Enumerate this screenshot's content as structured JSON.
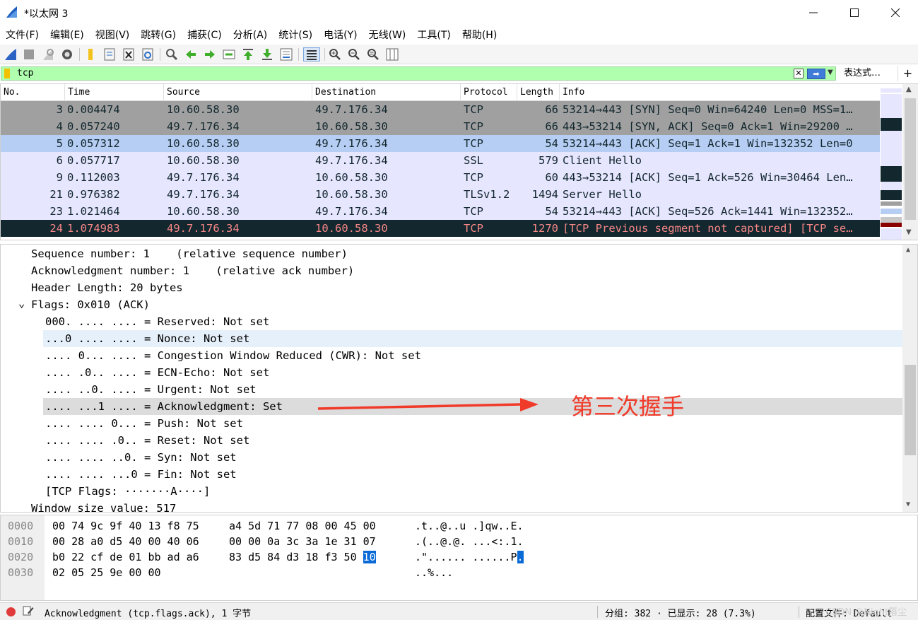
{
  "window": {
    "title": "*以太网 3"
  },
  "menu": [
    "文件(F)",
    "编辑(E)",
    "视图(V)",
    "跳转(G)",
    "捕获(C)",
    "分析(A)",
    "统计(S)",
    "电话(Y)",
    "无线(W)",
    "工具(T)",
    "帮助(H)"
  ],
  "toolbar": {
    "icons": [
      "start-capture-icon",
      "stop-capture-icon",
      "restart-capture-icon",
      "capture-options-icon",
      "open-file-icon",
      "save-file-icon",
      "close-file-icon",
      "reload-file-icon",
      "find-packet-icon",
      "go-back-icon",
      "go-forward-icon",
      "go-to-packet-icon",
      "go-first-icon",
      "go-last-icon",
      "autoscroll-icon",
      "colorize-icon",
      "zoom-in-icon",
      "zoom-out-icon",
      "zoom-normal-icon",
      "resize-columns-icon"
    ]
  },
  "filter": {
    "value": "tcp",
    "expression_label": "表达式…",
    "add_label": "+"
  },
  "packet_list": {
    "columns": [
      "No.",
      "Time",
      "Source",
      "Destination",
      "Protocol",
      "Length",
      "Info"
    ],
    "rows": [
      {
        "no": "3",
        "time": "0.004474",
        "src": "10.60.58.30",
        "dst": "49.7.176.34",
        "proto": "TCP",
        "len": "66",
        "info": "53214→443 [SYN] Seq=0 Win=64240 Len=0 MSS=1…",
        "bg": "#a0a0a0",
        "fg": "#12272e"
      },
      {
        "no": "4",
        "time": "0.057240",
        "src": "49.7.176.34",
        "dst": "10.60.58.30",
        "proto": "TCP",
        "len": "66",
        "info": "443→53214 [SYN, ACK] Seq=0 Ack=1 Win=29200 …",
        "bg": "#a0a0a0",
        "fg": "#12272e"
      },
      {
        "no": "5",
        "time": "0.057312",
        "src": "10.60.58.30",
        "dst": "49.7.176.34",
        "proto": "TCP",
        "len": "54",
        "info": "53214→443 [ACK] Seq=1 Ack=1 Win=132352 Len=0",
        "bg": "#b6cef3",
        "fg": "#12272e"
      },
      {
        "no": "6",
        "time": "0.057717",
        "src": "10.60.58.30",
        "dst": "49.7.176.34",
        "proto": "SSL",
        "len": "579",
        "info": "Client Hello",
        "bg": "#e7e6ff",
        "fg": "#12272e"
      },
      {
        "no": "9",
        "time": "0.112003",
        "src": "49.7.176.34",
        "dst": "10.60.58.30",
        "proto": "TCP",
        "len": "60",
        "info": "443→53214 [ACK] Seq=1 Ack=526 Win=30464 Len…",
        "bg": "#e7e6ff",
        "fg": "#12272e"
      },
      {
        "no": "21",
        "time": "0.976382",
        "src": "49.7.176.34",
        "dst": "10.60.58.30",
        "proto": "TLSv1.2",
        "len": "1494",
        "info": "Server Hello",
        "bg": "#e7e6ff",
        "fg": "#12272e"
      },
      {
        "no": "23",
        "time": "1.021464",
        "src": "10.60.58.30",
        "dst": "49.7.176.34",
        "proto": "TCP",
        "len": "54",
        "info": "53214→443 [ACK] Seq=526 Ack=1441 Win=132352…",
        "bg": "#e7e6ff",
        "fg": "#12272e"
      },
      {
        "no": "24",
        "time": "1.074983",
        "src": "49.7.176.34",
        "dst": "10.60.58.30",
        "proto": "TCP",
        "len": "1270",
        "info": "[TCP Previous segment not captured] [TCP se…",
        "bg": "#12272e",
        "fg": "#f78787"
      }
    ]
  },
  "details": {
    "lines": [
      {
        "text": "Sequence number: 1    (relative sequence number)",
        "indent": 0,
        "toggle": ""
      },
      {
        "text": "Acknowledgment number: 1    (relative ack number)",
        "indent": 0,
        "toggle": ""
      },
      {
        "text": "Header Length: 20 bytes",
        "indent": 0,
        "toggle": ""
      },
      {
        "text": "Flags: 0x010 (ACK)",
        "indent": 0,
        "toggle": "⌄"
      },
      {
        "text": "000. .... .... = Reserved: Not set",
        "indent": 1,
        "toggle": ""
      },
      {
        "text": "...0 .... .... = Nonce: Not set",
        "indent": 1,
        "toggle": "",
        "hover": true
      },
      {
        "text": ".... 0... .... = Congestion Window Reduced (CWR): Not set",
        "indent": 1,
        "toggle": ""
      },
      {
        "text": ".... .0.. .... = ECN-Echo: Not set",
        "indent": 1,
        "toggle": ""
      },
      {
        "text": ".... ..0. .... = Urgent: Not set",
        "indent": 1,
        "toggle": ""
      },
      {
        "text": ".... ...1 .... = Acknowledgment: Set",
        "indent": 1,
        "toggle": "",
        "selected": true
      },
      {
        "text": ".... .... 0... = Push: Not set",
        "indent": 1,
        "toggle": ""
      },
      {
        "text": ".... .... .0.. = Reset: Not set",
        "indent": 1,
        "toggle": ""
      },
      {
        "text": ".... .... ..0. = Syn: Not set",
        "indent": 1,
        "toggle": ""
      },
      {
        "text": ".... .... ...0 = Fin: Not set",
        "indent": 1,
        "toggle": ""
      },
      {
        "text": "[TCP Flags: ·······A····]",
        "indent": 1,
        "toggle": ""
      },
      {
        "text": "Window size value: 517",
        "indent": 0,
        "toggle": ""
      }
    ],
    "annotation": "第三次握手",
    "annotation_color": "#f03a2a"
  },
  "bytes": {
    "rows": [
      {
        "offset": "0000",
        "hex1": "00 74 9c 9f 40 13 f8 75",
        "hex2": "a4 5d 71 77 08 00 45 00",
        "hex2_hl": "",
        "ascii": ".t..@..u .]qw..E.",
        "ascii_hl": ""
      },
      {
        "offset": "0010",
        "hex1": "00 28 a0 d5 40 00 40 06",
        "hex2": "00 00 0a 3c 3a 1e 31 07",
        "hex2_hl": "",
        "ascii": ".(..@.@. ...<:.1.",
        "ascii_hl": ""
      },
      {
        "offset": "0020",
        "hex1": "b0 22 cf de 01 bb ad a6",
        "hex2": "83 d5 84 d3 18 f3 50 ",
        "hex2_hl": "10",
        "ascii": ".\"...... ......P",
        "ascii_hl": "."
      },
      {
        "offset": "0030",
        "hex1": "02 05 25 9e 00 00",
        "hex2": "",
        "hex2_hl": "",
        "ascii": "..%...",
        "ascii_hl": ""
      }
    ],
    "highlight_color": "#0a6bd6"
  },
  "status": {
    "field": "Acknowledgment (tcp.flags.ack), 1 字节",
    "packets": "分组: 382 · 已显示: 28 (7.3%)",
    "profile": "配置文件: Default",
    "watermark": "CSDN @Night落尘"
  },
  "colors": {
    "filter_valid_bg": "#afffaf",
    "selected_row": "#b6cef3"
  }
}
